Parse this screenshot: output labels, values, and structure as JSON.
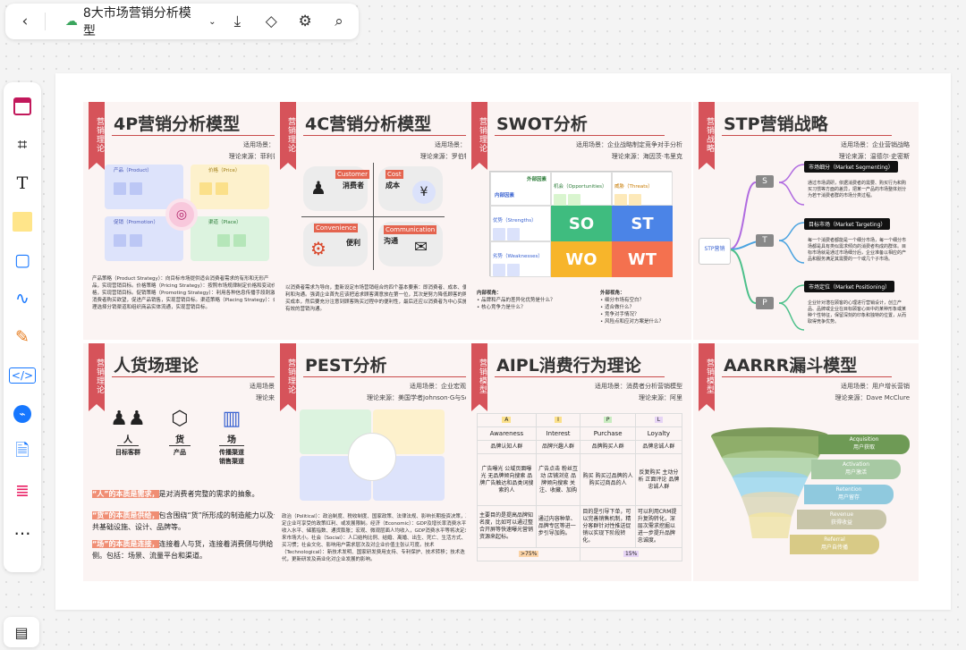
{
  "toolbar": {
    "title": "8大市场营销分析模型"
  },
  "cards": {
    "c4p": {
      "ribbon": "营销理论",
      "title": "4P营销分析模型",
      "meta1": "适用场景：商业模式",
      "meta2": "理论来源：菲利普·科特勒",
      "q1": "产品（Product）",
      "q2": "价格（Price）",
      "q3": "促销（Promotion）",
      "q4": "渠道（Place）",
      "desc": "产品策略（Product Strategy）：向目标市场提供适合消费者需求的有形和无形产品，实现营销目标。价格策略（Pricing Strategy）：按照市场规律制定价格和变动价格，实现营销目标。促销策略（Promoting Strategy）：利用各种信息传播手段刺激消费者购买欲望，促进产品销售，实现营销目标。渠道策略（Placing Strategy）：合理选择分销渠道和组织商品实体流通，实现营销目标。"
    },
    "c4c": {
      "ribbon": "营销理论",
      "title": "4C营销分析模型",
      "meta1": "适用场景：商业模式",
      "meta2": "理论来源：罗伯特·劳特朋",
      "a1": "Customer",
      "b1": "消费者",
      "a2": "Cost",
      "b2": "成本",
      "a3": "Convenience",
      "b3": "便利",
      "a4": "Communication",
      "b4": "沟通",
      "desc": "以消费者需求为导向，重新设定市场营销组合的四个基本要素：即消费者、成本、便利和沟通。强调企业首先应该把追求顾客满意放在第一位，其次是努力降低顾客的购买成本，然后要充分注意到顾客购买过程中的便利性，最后还应以消费者为中心实施有效的营销沟通。"
    },
    "swot": {
      "ribbon": "营销理论",
      "title": "SWOT分析",
      "meta1": "适用场景：企业战略制定竞争对手分析",
      "meta2": "理论来源：海因茨·韦里克",
      "ext": "外部因素",
      "int": "内部因素",
      "o": "机会（Opportunities）",
      "t": "威胁（Threats）",
      "s": "优势（Strengths）",
      "w": "劣势（Weaknesses）",
      "so": "SO",
      "st": "ST",
      "wo": "WO",
      "wt": "WT",
      "inner_title": "内部视角：",
      "inner1": "品牌和产品的差异化优势是什么？",
      "inner2": "核心竞争力是什么？",
      "outer_title": "外部视角：",
      "outer1": "细分市场有空白？",
      "outer2": "适合做什么？",
      "outer3": "竞争对手情况？",
      "outer4": "风险点和应对方案是什么？"
    },
    "stp": {
      "ribbon": "营销战略",
      "title": "STP营销战略",
      "meta1": "适用场景：企业营销战略",
      "meta2": "理论来源：温德尔·史密斯",
      "center": "STP营销",
      "s": "S",
      "t": "T",
      "p": "P",
      "seg": "市场细分（Market Segmenting）",
      "tar": "目标市场（Market Targeting）",
      "posi": "市场定位（Market Positioning）",
      "seg_d": "通过市场调研，依据消费者的需要、购买行为和购买习惯等方面的差异，把某一产品的市场整体划分为若干消费者群的市场分类过程。",
      "tar_d": "每一个消费者都能是一个细分市场，每一个细分市场都是具有类似需求倾向的消费者构成的群体。目标市场就是通过市场细分后，企业准备以相应的产品和服务满足其需要的一个或几个子市场。",
      "pos_d": "企业针对潜在顾客的心理进行营销设计，创立产品、品牌或企业在目标顾客心目中的某种形象或某种个性特征，保留深刻的印象和独特的位置，从而取得竞争优势。"
    },
    "rhc": {
      "ribbon": "营销理论",
      "title": "人货场理论",
      "meta1": "适用场景：新零售",
      "meta2": "理论来源：阿里",
      "ren": "人",
      "ren_s": "目标客群",
      "huo": "货",
      "huo_s": "产品",
      "chang": "场",
      "chang_s1": "传播渠道",
      "chang_s2": "销售渠道",
      "p1h": "“人”的本质是需求，",
      "p1": "是对消费者完整的需求的抽象。",
      "p2h": "“货”的本质是供给，",
      "p2": "包含围绕“货”所形成的制造能力以及公共基础设施、设计、品牌等。",
      "p3h": "“场”的本质是连接，",
      "p3": "连接着人与货，连接着消费侧与供给侧。包括：场景、流量平台和渠道。"
    },
    "pest": {
      "ribbon": "营销理论",
      "title": "PEST分析",
      "meta1": "适用场景：企业宏观环境分析",
      "meta2": "理论来源：美国学者Johnson·G与Scholes·K",
      "desc": "政治（Political）：政治制度、税收制度、国家政策、法律法规、影响长期投资决策，决定企业可享受的政策红利、或发展限制。经济（Economic）：GDP及增长率消费水平、收入水平、储蓄指数、通货膨胀；宏观、微观层面人均收入，GDP消费水平等将决定未来市场大小。社会（Social）：人口结构比例、结婚、离婚、出生、死亡、生活方式、购买习惯；社会文化、影响用户需求层次及对企业价值主张认可度。技术（Technological）：新技术发明、国家研发费用支持、专利保护、技术转移；技术迭代，更新研发及商业化对企业发展的影响。"
    },
    "aipl": {
      "ribbon": "营销模型",
      "title": "AIPL消费行为理论",
      "meta1": "适用场景：消费者分析营销模型",
      "meta2": "理论来源：阿里",
      "letters": [
        "A",
        "I",
        "P",
        "L"
      ],
      "names": [
        "Awareness",
        "Interest",
        "Purchase",
        "Loyalty"
      ],
      "groups": [
        "品牌认知人群",
        "品牌兴趣人群",
        "品牌购买人群",
        "品牌忠诚人群"
      ],
      "acts": [
        "广告曝光 公域页面曝光 无品牌倾向搜索 品牌广告触达和品类词搜索的人",
        "广告点击 粉丝互动 店铺浏览 品牌倾向搜索 关注、收藏、加购",
        "购买 购买过品牌的人 购买过商品的人",
        "反复购买 主动分析 正面评论 品牌忠诚人群"
      ],
      "tips": [
        "主要目的是提高品牌知名度，比如可以通过整合开屏等快速曝光营销资源来起标。",
        "通过内容种草、品牌专区等进一步引导加购。",
        "目的是引导下单，可以完善销售机制，精分客群针对性推送促销以实现下阶段转化。",
        "可以利用CRM提升复购转化，深层次需求挖掘以进一步提升品牌忠诚度。"
      ],
      "pct1": ">75%",
      "pct2": "15%"
    },
    "aarrr": {
      "ribbon": "营销模型",
      "title": "AARRR漏斗模型",
      "meta1": "适用场景：用户增长营销",
      "meta2": "理论来源：Dave McClure",
      "l1a": "Acquisition",
      "l1b": "用户获取",
      "l2a": "Activation",
      "l2b": "用户激活",
      "l3a": "Retention",
      "l3b": "用户留存",
      "l4a": "Revenue",
      "l4b": "获得收益",
      "l5a": "Referral",
      "l5b": "用户自传播"
    }
  }
}
